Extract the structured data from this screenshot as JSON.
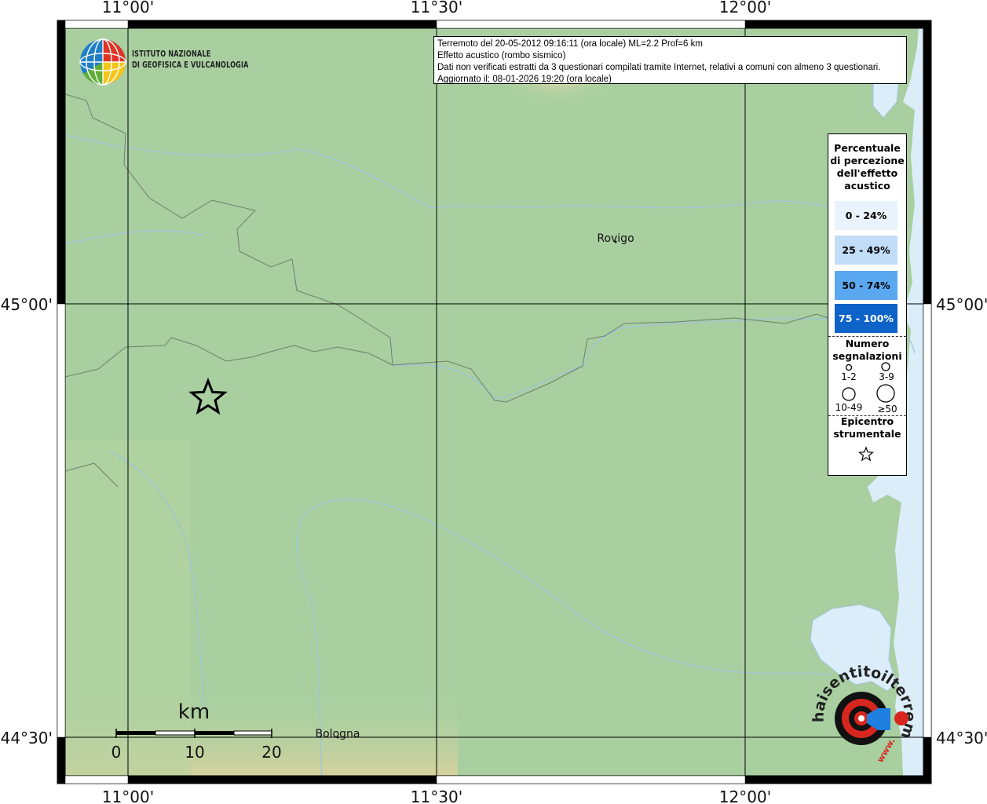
{
  "header": {
    "lines": [
      "Terremoto del 20-05-2012 09:16:11 (ora locale) ML=2.2 Prof=6 km",
      "Effetto acustico (rombo sismico)",
      "Dati non verificati estratti da 3 questionari compilati tramite Internet, relativi a comuni con almeno 3 questionari.",
      "Aggiornato il: 08-01-2026 19:20 (ora locale)"
    ]
  },
  "logo": {
    "line1": "ISTITUTO NAZIONALE",
    "line2": "DI GEOFISICA E VULCANOLOGIA"
  },
  "map": {
    "lon_ticks": [
      "11°00'",
      "11°30'",
      "12°00'"
    ],
    "lat_ticks": [
      "45°00'",
      "44°30'"
    ],
    "places": [
      {
        "name": "Rovigo",
        "lat": 45.07,
        "lon": 11.79
      },
      {
        "name": "Bologna",
        "lat": 44.49,
        "lon": 11.34
      }
    ],
    "epicenter": {
      "lat": 44.85,
      "lon": 11.13
    },
    "colors": {
      "land": "#a9cfa0",
      "land_hills": "#c8d8a0",
      "sea": "#dcedfa",
      "rivers": "#9ec4d8",
      "borders": "#6e7e6a",
      "grid": "#000000"
    }
  },
  "scalebar": {
    "unit": "km",
    "labels": [
      "0",
      "10",
      "20"
    ]
  },
  "legend": {
    "title": "Percentuale di percezione dell'effetto acustico",
    "title_lines": [
      "Percentuale",
      "di percezione",
      "dell'effetto",
      "acustico"
    ],
    "classes": [
      {
        "label": "0 - 24%",
        "color": "#e8f3fd",
        "text_color": "#000000"
      },
      {
        "label": "25 - 49%",
        "color": "#c2ddf7",
        "text_color": "#000000"
      },
      {
        "label": "50 - 74%",
        "color": "#5aa8f0",
        "text_color": "#000000"
      },
      {
        "label": "75 - 100%",
        "color": "#0e63c8",
        "text_color": "#ffffff"
      }
    ],
    "count_title_lines": [
      "Numero",
      "segnalazioni"
    ],
    "count_sizes": [
      "1-2",
      "3-9",
      "10-49",
      "≥50"
    ],
    "epicenter_title_lines": [
      "Epicentro",
      "strumentale"
    ]
  },
  "watermark": {
    "text": "haisentitoilterremoto.it",
    "prefix": "www."
  }
}
